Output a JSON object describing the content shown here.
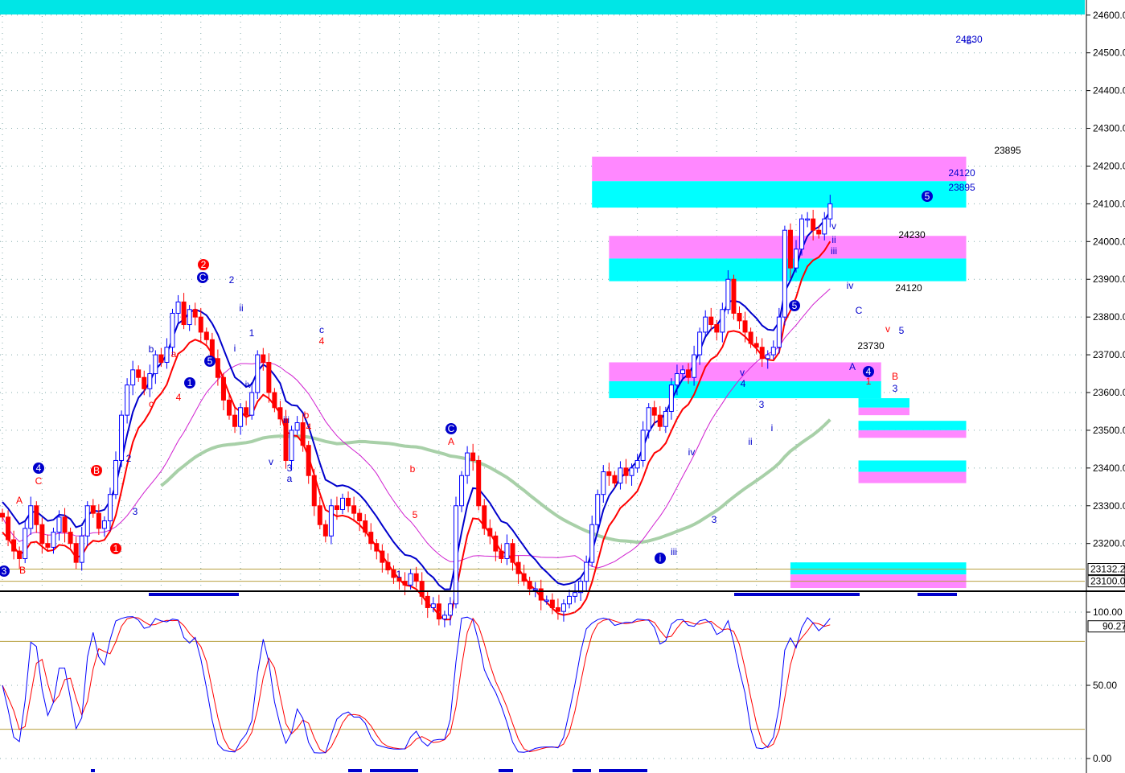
{
  "chart_data": [
    {
      "type": "candlestick",
      "panel": "price",
      "title": "",
      "xlabel": "",
      "ylabel": "",
      "ylim": [
        23080,
        24640
      ],
      "yticks": [
        "24600.00",
        "24500.00",
        "24400.00",
        "24300.00",
        "24200.00",
        "24100.00",
        "24000.00",
        "23900.00",
        "23800.00",
        "23700.00",
        "23600.00",
        "23500.00",
        "23400.00",
        "23300.00",
        "23200.00"
      ],
      "grid": true,
      "price_tags": [
        "23132.2",
        "23100.0"
      ],
      "levels": [
        {
          "label": "24230",
          "value": 24230
        },
        {
          "label": "24120",
          "value": 24120
        },
        {
          "label": "23895",
          "value": 23895
        },
        {
          "label": "23730",
          "value": 23730
        }
      ],
      "annotation_marker": "-5-",
      "colors": {
        "up": "#0000ff",
        "down": "#ff0000",
        "fast_ma": "#ff0000",
        "slow_ma": "#0000cc",
        "long_ma": "#a8d0a8",
        "mid_ma": "#d020d0",
        "zone_cyan": "#00ffff",
        "zone_magenta": "#ff88ff",
        "top_band": "#00e6e6"
      },
      "zones": [
        {
          "from_bar": 104,
          "to_bar": 170,
          "lo": 24160,
          "hi": 24225,
          "color": "magenta"
        },
        {
          "from_bar": 104,
          "to_bar": 170,
          "lo": 24090,
          "hi": 24160,
          "color": "cyan"
        },
        {
          "from_bar": 107,
          "to_bar": 170,
          "lo": 23955,
          "hi": 24015,
          "color": "magenta"
        },
        {
          "from_bar": 107,
          "to_bar": 170,
          "lo": 23895,
          "hi": 23955,
          "color": "cyan"
        },
        {
          "from_bar": 107,
          "to_bar": 155,
          "lo": 23630,
          "hi": 23680,
          "color": "magenta"
        },
        {
          "from_bar": 107,
          "to_bar": 155,
          "lo": 23585,
          "hi": 23630,
          "color": "cyan"
        },
        {
          "from_bar": 151,
          "to_bar": 160,
          "lo": 23560,
          "hi": 23585,
          "color": "cyan"
        },
        {
          "from_bar": 151,
          "to_bar": 160,
          "lo": 23540,
          "hi": 23560,
          "color": "magenta"
        },
        {
          "from_bar": 151,
          "to_bar": 170,
          "lo": 23500,
          "hi": 23525,
          "color": "cyan"
        },
        {
          "from_bar": 151,
          "to_bar": 170,
          "lo": 23480,
          "hi": 23500,
          "color": "magenta"
        },
        {
          "from_bar": 151,
          "to_bar": 170,
          "lo": 23390,
          "hi": 23420,
          "color": "cyan"
        },
        {
          "from_bar": 151,
          "to_bar": 170,
          "lo": 23360,
          "hi": 23390,
          "color": "magenta"
        },
        {
          "from_bar": 139,
          "to_bar": 170,
          "lo": 23118,
          "hi": 23150,
          "color": "cyan"
        },
        {
          "from_bar": 139,
          "to_bar": 170,
          "lo": 23082,
          "hi": 23118,
          "color": "magenta"
        }
      ],
      "close": [
        23270,
        23210,
        23180,
        23160,
        23240,
        23300,
        23250,
        23200,
        23190,
        23230,
        23270,
        23230,
        23200,
        23150,
        23220,
        23300,
        23280,
        23240,
        23260,
        23330,
        23420,
        23540,
        23620,
        23660,
        23640,
        23610,
        23650,
        23700,
        23680,
        23720,
        23810,
        23840,
        23780,
        23820,
        23800,
        23760,
        23740,
        23690,
        23640,
        23580,
        23540,
        23510,
        23560,
        23540,
        23600,
        23700,
        23680,
        23600,
        23560,
        23530,
        23420,
        23500,
        23520,
        23460,
        23380,
        23300,
        23250,
        23220,
        23300,
        23290,
        23320,
        23300,
        23280,
        23260,
        23230,
        23200,
        23180,
        23150,
        23130,
        23110,
        23100,
        23090,
        23120,
        23100,
        23060,
        23030,
        23040,
        23000,
        23010,
        23040,
        23300,
        23380,
        23440,
        23420,
        23300,
        23240,
        23220,
        23180,
        23160,
        23200,
        23150,
        23120,
        23100,
        23080,
        23080,
        23050,
        23050,
        23030,
        23020,
        23040,
        23060,
        23070,
        23100,
        23150,
        23250,
        23330,
        23390,
        23380,
        23360,
        23400,
        23380,
        23400,
        23420,
        23500,
        23560,
        23540,
        23510,
        23550,
        23620,
        23650,
        23660,
        23640,
        23700,
        23760,
        23800,
        23780,
        23760,
        23820,
        23900,
        23810,
        23790,
        23760,
        23730,
        23720,
        23690,
        23700,
        23720,
        23800,
        24030,
        23930,
        23980,
        24060,
        24060,
        24030,
        24020,
        24060,
        24100
      ],
      "series": [
        {
          "name": "",
          "panel": "oscillator",
          "ylim": [
            0,
            100
          ],
          "yticks": [
            "100.00",
            "50.00",
            "0.00"
          ],
          "reference_lines": [
            80,
            20
          ],
          "last_value_tag": "90.27"
        }
      ],
      "price_wave_labels": [
        "3",
        "B",
        "4",
        "C",
        "A",
        "B",
        "1",
        "2",
        "3",
        "b",
        "a",
        "c",
        "4",
        "1",
        "5",
        "C",
        "2",
        "2",
        "ii",
        "1",
        "i",
        "iv",
        "iii",
        "v",
        "3",
        "a",
        "b",
        "4",
        "c",
        "4",
        "C",
        "A",
        "b",
        "5",
        "1",
        "i",
        "iii",
        "iv",
        "3",
        "v",
        "4",
        "ii",
        "i",
        "3",
        "5",
        "v",
        "ii",
        "iii",
        "iv",
        "A",
        "C",
        "4",
        "1",
        "B",
        "3",
        "5",
        "v",
        "5",
        "24120",
        "23895",
        "24230",
        "23730"
      ]
    }
  ]
}
